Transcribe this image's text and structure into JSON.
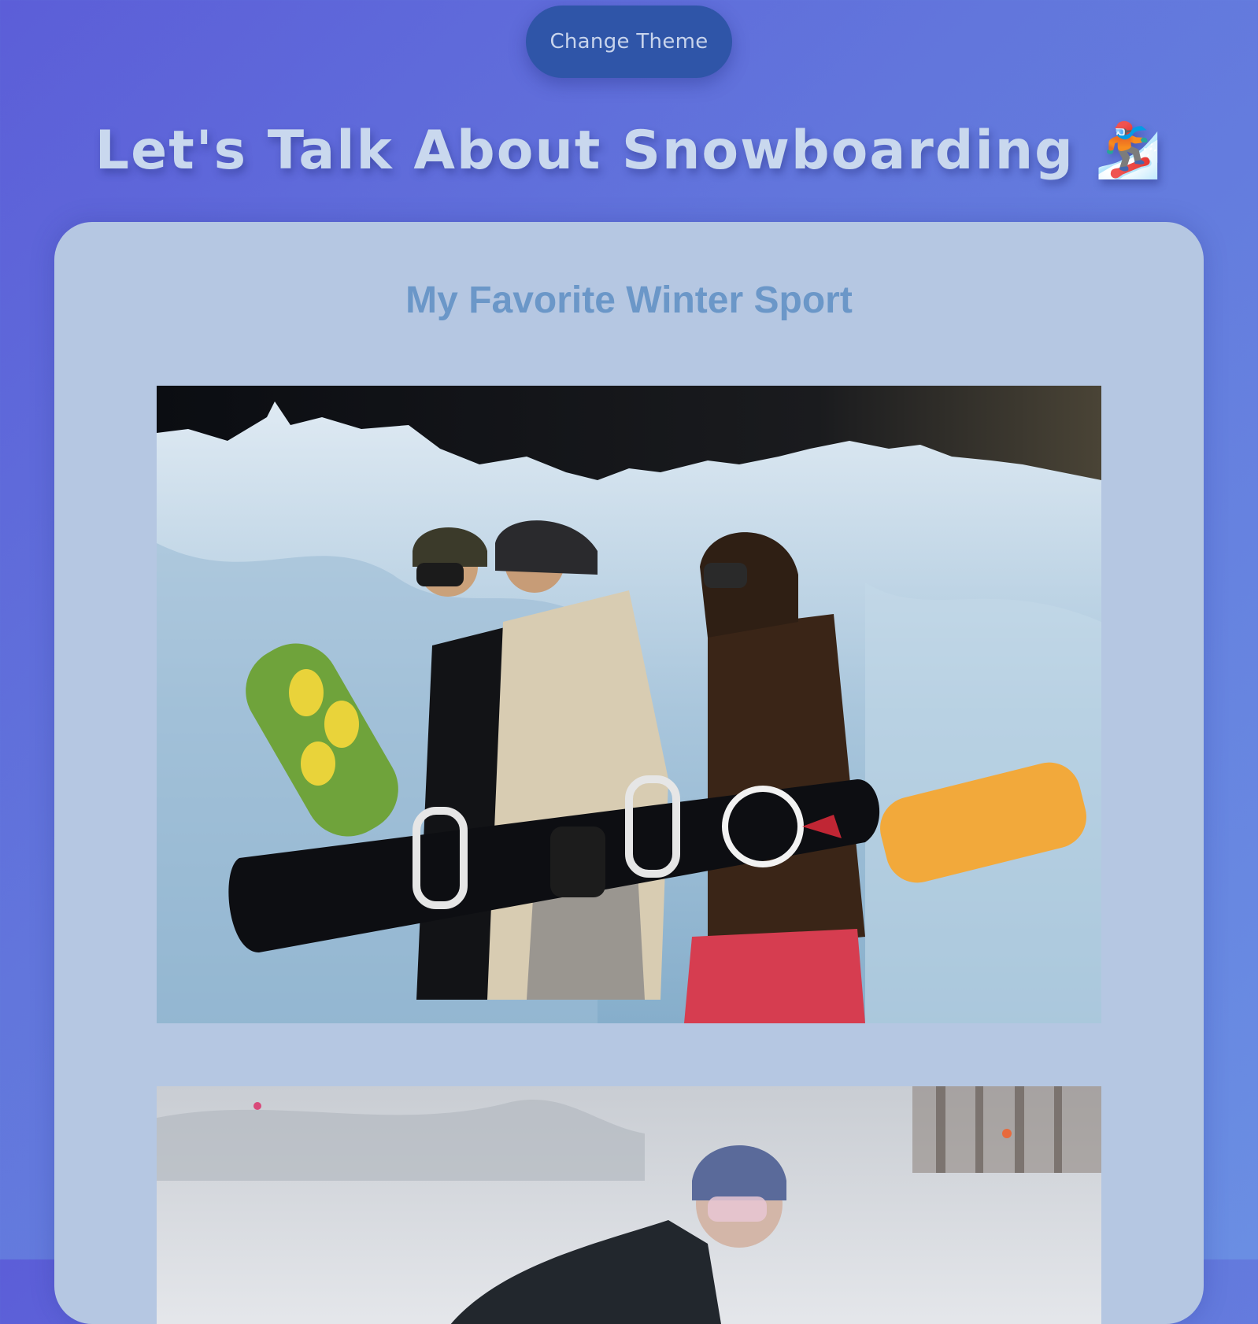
{
  "header": {
    "theme_button_label": "Change Theme",
    "title": "Let's Talk About Snowboarding 🏂"
  },
  "content": {
    "heading": "My Favorite Winter Sport",
    "photos": [
      {
        "subject": "three snowboarders walking carrying snowboards in front of a snow bank"
      },
      {
        "subject": "snowboarder in helmet and goggles crouching on a snowy slope"
      }
    ]
  },
  "colors": {
    "background": "#6276dc",
    "button": "#2f55a8",
    "title_text": "#c9d8ee",
    "card": "#b5c7e2",
    "heading_text": "#6b97c8"
  }
}
